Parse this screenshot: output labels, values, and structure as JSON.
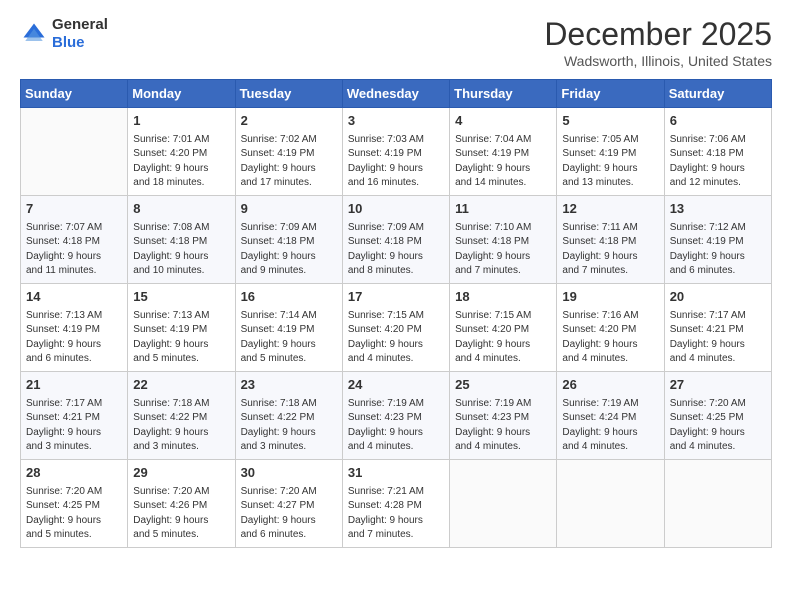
{
  "header": {
    "logo_line1": "General",
    "logo_line2": "Blue",
    "month_title": "December 2025",
    "location": "Wadsworth, Illinois, United States"
  },
  "weekdays": [
    "Sunday",
    "Monday",
    "Tuesday",
    "Wednesday",
    "Thursday",
    "Friday",
    "Saturday"
  ],
  "weeks": [
    [
      {
        "day": "",
        "info": ""
      },
      {
        "day": "1",
        "info": "Sunrise: 7:01 AM\nSunset: 4:20 PM\nDaylight: 9 hours\nand 18 minutes."
      },
      {
        "day": "2",
        "info": "Sunrise: 7:02 AM\nSunset: 4:19 PM\nDaylight: 9 hours\nand 17 minutes."
      },
      {
        "day": "3",
        "info": "Sunrise: 7:03 AM\nSunset: 4:19 PM\nDaylight: 9 hours\nand 16 minutes."
      },
      {
        "day": "4",
        "info": "Sunrise: 7:04 AM\nSunset: 4:19 PM\nDaylight: 9 hours\nand 14 minutes."
      },
      {
        "day": "5",
        "info": "Sunrise: 7:05 AM\nSunset: 4:19 PM\nDaylight: 9 hours\nand 13 minutes."
      },
      {
        "day": "6",
        "info": "Sunrise: 7:06 AM\nSunset: 4:18 PM\nDaylight: 9 hours\nand 12 minutes."
      }
    ],
    [
      {
        "day": "7",
        "info": "Sunrise: 7:07 AM\nSunset: 4:18 PM\nDaylight: 9 hours\nand 11 minutes."
      },
      {
        "day": "8",
        "info": "Sunrise: 7:08 AM\nSunset: 4:18 PM\nDaylight: 9 hours\nand 10 minutes."
      },
      {
        "day": "9",
        "info": "Sunrise: 7:09 AM\nSunset: 4:18 PM\nDaylight: 9 hours\nand 9 minutes."
      },
      {
        "day": "10",
        "info": "Sunrise: 7:09 AM\nSunset: 4:18 PM\nDaylight: 9 hours\nand 8 minutes."
      },
      {
        "day": "11",
        "info": "Sunrise: 7:10 AM\nSunset: 4:18 PM\nDaylight: 9 hours\nand 7 minutes."
      },
      {
        "day": "12",
        "info": "Sunrise: 7:11 AM\nSunset: 4:18 PM\nDaylight: 9 hours\nand 7 minutes."
      },
      {
        "day": "13",
        "info": "Sunrise: 7:12 AM\nSunset: 4:19 PM\nDaylight: 9 hours\nand 6 minutes."
      }
    ],
    [
      {
        "day": "14",
        "info": "Sunrise: 7:13 AM\nSunset: 4:19 PM\nDaylight: 9 hours\nand 6 minutes."
      },
      {
        "day": "15",
        "info": "Sunrise: 7:13 AM\nSunset: 4:19 PM\nDaylight: 9 hours\nand 5 minutes."
      },
      {
        "day": "16",
        "info": "Sunrise: 7:14 AM\nSunset: 4:19 PM\nDaylight: 9 hours\nand 5 minutes."
      },
      {
        "day": "17",
        "info": "Sunrise: 7:15 AM\nSunset: 4:20 PM\nDaylight: 9 hours\nand 4 minutes."
      },
      {
        "day": "18",
        "info": "Sunrise: 7:15 AM\nSunset: 4:20 PM\nDaylight: 9 hours\nand 4 minutes."
      },
      {
        "day": "19",
        "info": "Sunrise: 7:16 AM\nSunset: 4:20 PM\nDaylight: 9 hours\nand 4 minutes."
      },
      {
        "day": "20",
        "info": "Sunrise: 7:17 AM\nSunset: 4:21 PM\nDaylight: 9 hours\nand 4 minutes."
      }
    ],
    [
      {
        "day": "21",
        "info": "Sunrise: 7:17 AM\nSunset: 4:21 PM\nDaylight: 9 hours\nand 3 minutes."
      },
      {
        "day": "22",
        "info": "Sunrise: 7:18 AM\nSunset: 4:22 PM\nDaylight: 9 hours\nand 3 minutes."
      },
      {
        "day": "23",
        "info": "Sunrise: 7:18 AM\nSunset: 4:22 PM\nDaylight: 9 hours\nand 3 minutes."
      },
      {
        "day": "24",
        "info": "Sunrise: 7:19 AM\nSunset: 4:23 PM\nDaylight: 9 hours\nand 4 minutes."
      },
      {
        "day": "25",
        "info": "Sunrise: 7:19 AM\nSunset: 4:23 PM\nDaylight: 9 hours\nand 4 minutes."
      },
      {
        "day": "26",
        "info": "Sunrise: 7:19 AM\nSunset: 4:24 PM\nDaylight: 9 hours\nand 4 minutes."
      },
      {
        "day": "27",
        "info": "Sunrise: 7:20 AM\nSunset: 4:25 PM\nDaylight: 9 hours\nand 4 minutes."
      }
    ],
    [
      {
        "day": "28",
        "info": "Sunrise: 7:20 AM\nSunset: 4:25 PM\nDaylight: 9 hours\nand 5 minutes."
      },
      {
        "day": "29",
        "info": "Sunrise: 7:20 AM\nSunset: 4:26 PM\nDaylight: 9 hours\nand 5 minutes."
      },
      {
        "day": "30",
        "info": "Sunrise: 7:20 AM\nSunset: 4:27 PM\nDaylight: 9 hours\nand 6 minutes."
      },
      {
        "day": "31",
        "info": "Sunrise: 7:21 AM\nSunset: 4:28 PM\nDaylight: 9 hours\nand 7 minutes."
      },
      {
        "day": "",
        "info": ""
      },
      {
        "day": "",
        "info": ""
      },
      {
        "day": "",
        "info": ""
      }
    ]
  ]
}
